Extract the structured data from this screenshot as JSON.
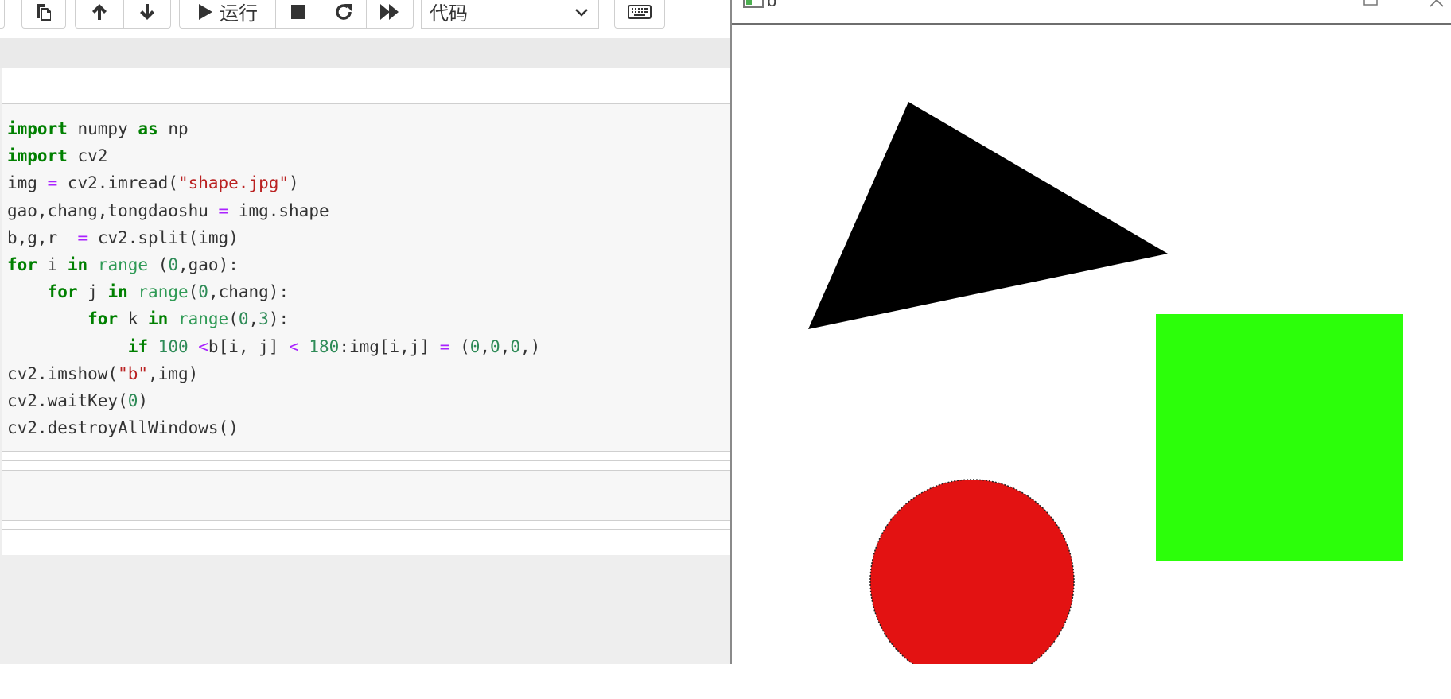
{
  "toolbar": {
    "run_label": "运行",
    "cell_type_value": "代码",
    "icons": [
      "copy-icon",
      "arrow-up-icon",
      "arrow-down-icon",
      "play-icon",
      "stop-icon",
      "restart-icon",
      "fast-forward-icon",
      "keyboard-icon"
    ]
  },
  "code_cell": {
    "language": "python",
    "lines": [
      "import numpy as np",
      "import cv2",
      "img = cv2.imread(\"shape.jpg\")",
      "gao,chang,tongdaoshu = img.shape",
      "b,g,r  = cv2.split(img)",
      "for i in range (0,gao):",
      "    for j in range(0,chang):",
      "        for k in range(0,3):",
      "            if 100 <b[i, j] < 180:img[i,j] = (0,0,0,)",
      "cv2.imshow(\"b\",img)",
      "cv2.waitKey(0)",
      "cv2.destroyAllWindows()"
    ]
  },
  "cv_window": {
    "title": "b",
    "shapes": [
      {
        "kind": "triangle",
        "color": "#000000"
      },
      {
        "kind": "square",
        "color": "#2cff0a"
      },
      {
        "kind": "circle",
        "color": "#e31212"
      }
    ]
  }
}
